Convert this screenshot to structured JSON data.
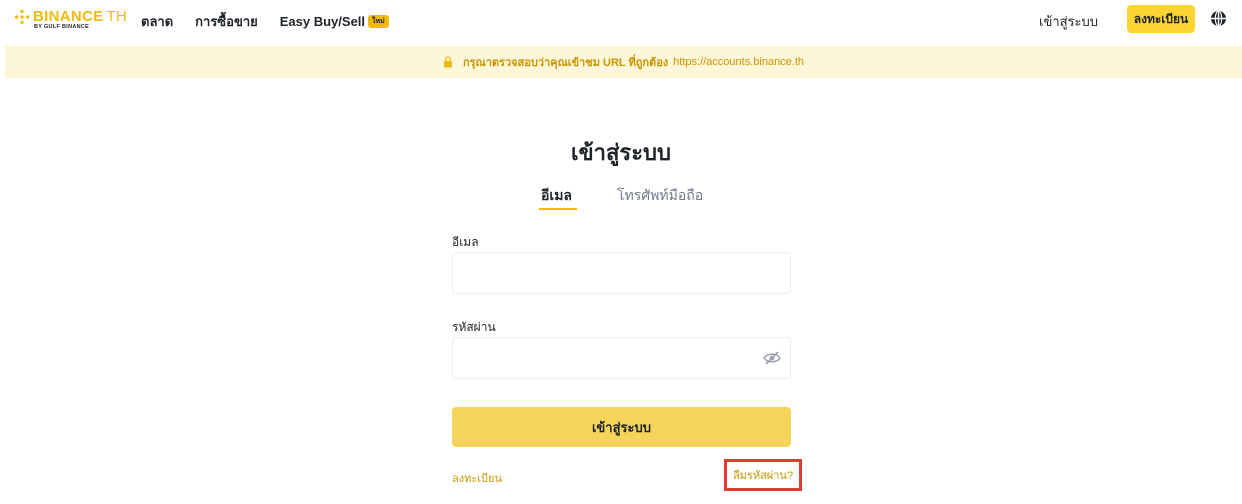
{
  "header": {
    "logo_text": "BINANCE",
    "logo_suffix": "TH",
    "logo_sub": "BY GULF BINANCE",
    "nav": [
      {
        "label": "ตลาด"
      },
      {
        "label": "การซื้อขาย"
      },
      {
        "label": "Easy Buy/Sell",
        "badge": "ใหม่"
      }
    ],
    "login_label": "เข้าสู่ระบบ",
    "register_label": "ลงทะเบียน"
  },
  "notice": {
    "text": "กรุณาตรวจสอบว่าคุณเข้าชม URL ที่ถูกต้อง",
    "url": "https://accounts.binance.th"
  },
  "main": {
    "title": "เข้าสู่ระบบ",
    "tabs": [
      {
        "label": "อีเมล",
        "active": true
      },
      {
        "label": "โทรศัพท์มือถือ",
        "active": false
      }
    ],
    "email_label": "อีเมล",
    "email_value": "",
    "password_label": "รหัสผ่าน",
    "password_value": "",
    "submit_label": "เข้าสู่ระบบ",
    "register_link": "ลงทะเบียน",
    "forgot_link": "ลืมรหัสผ่าน?"
  },
  "icons": {
    "logo": "binance-logo-icon",
    "globe": "globe-icon",
    "lock": "lock-icon",
    "eye": "eye-hidden-icon"
  },
  "colors": {
    "brand": "#F0B90B",
    "button": "#FCD535",
    "link": "#C99400",
    "notice_bg": "#FEF6D8",
    "highlight": "#E03C31"
  }
}
